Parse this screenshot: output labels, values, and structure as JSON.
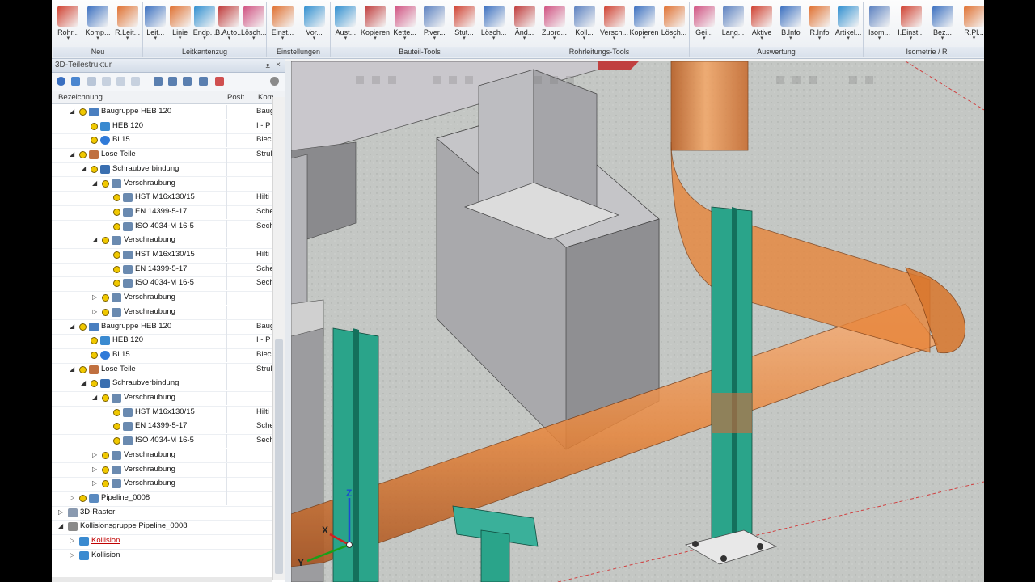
{
  "ribbon": {
    "groups": [
      {
        "title": "Neu",
        "buttons": [
          {
            "label": "Rohr...",
            "icon": "pipe-icon"
          },
          {
            "label": "Komp...",
            "icon": "component-icon"
          },
          {
            "label": "R.Leit...",
            "icon": "pipeline-icon"
          }
        ]
      },
      {
        "title": "Leitkantenzug",
        "buttons": [
          {
            "label": "Leit...",
            "icon": "guide-line-icon"
          },
          {
            "label": "Linie",
            "icon": "line-icon"
          },
          {
            "label": "Endp...",
            "icon": "endpoint-xyz-icon"
          },
          {
            "label": "B.Auto...",
            "icon": "auto-bend-icon"
          },
          {
            "label": "Lösch...",
            "icon": "delete-line-icon"
          }
        ]
      },
      {
        "title": "Einstellungen",
        "buttons": [
          {
            "label": "Einst...",
            "icon": "settings-icon"
          },
          {
            "label": "Vor...",
            "icon": "defaults-icon"
          }
        ]
      },
      {
        "title": "Bauteil-Tools",
        "buttons": [
          {
            "label": "Aust...",
            "icon": "replace-icon"
          },
          {
            "label": "Kopieren",
            "icon": "copy-icon"
          },
          {
            "label": "Kette...",
            "icon": "chain-icon"
          },
          {
            "label": "P.ver...",
            "icon": "move-point-icon"
          },
          {
            "label": "Stut...",
            "icon": "nozzle-icon"
          },
          {
            "label": "Lösch...",
            "icon": "delete-part-icon"
          }
        ]
      },
      {
        "title": "Rohrleitungs-Tools",
        "buttons": [
          {
            "label": "Änd...",
            "icon": "modify-icon"
          },
          {
            "label": "Zuord...",
            "icon": "assign-icon"
          },
          {
            "label": "Koll...",
            "icon": "collision-icon"
          },
          {
            "label": "Versch...",
            "icon": "move-icon"
          },
          {
            "label": "Kopieren",
            "icon": "copy-pipe-icon"
          },
          {
            "label": "Lösch...",
            "icon": "delete-pipe-icon"
          }
        ]
      },
      {
        "title": "Auswertung",
        "buttons": [
          {
            "label": "Gei...",
            "icon": "geometry-icon"
          },
          {
            "label": "Lang...",
            "icon": "length-sum-icon"
          },
          {
            "label": "Aktive",
            "icon": "active-icon"
          },
          {
            "label": "B.Info",
            "icon": "part-info-icon"
          },
          {
            "label": "R.Info",
            "icon": "pipe-info-icon"
          },
          {
            "label": "Artikel...",
            "icon": "article-icon"
          }
        ]
      },
      {
        "title": "Isometrie / R",
        "buttons": [
          {
            "label": "Isom...",
            "icon": "iso-icon"
          },
          {
            "label": "I.Einst...",
            "icon": "iso-settings-icon"
          },
          {
            "label": "Bez...",
            "icon": "reference-icon"
          },
          {
            "label": "R.Pl...",
            "icon": "pipe-plan-icon"
          }
        ]
      }
    ]
  },
  "panel": {
    "title": "3D-Teilestruktur",
    "pin": "ᴥ",
    "close": "×",
    "columns": {
      "name": "Bezeichnung",
      "pos": "Posit...",
      "kom": "Kom"
    },
    "rows": [
      {
        "level": 1,
        "exp": "◢",
        "name": "Baugruppe HEB 120",
        "kom": "Baug",
        "type": "assembly"
      },
      {
        "level": 2,
        "exp": "",
        "name": "HEB 120",
        "kom": "I - P",
        "type": "beam"
      },
      {
        "level": 2,
        "exp": "",
        "name": "Bl 15",
        "kom": "Blec",
        "type": "plate"
      },
      {
        "level": 1,
        "exp": "◢",
        "name": "Lose Teile",
        "kom": "Strul",
        "type": "loose"
      },
      {
        "level": 2,
        "exp": "◢",
        "name": "Schraubverbindung",
        "kom": "",
        "type": "bolt-group"
      },
      {
        "level": 3,
        "exp": "◢",
        "name": "Verschraubung",
        "kom": "",
        "type": "screw"
      },
      {
        "level": 4,
        "exp": "",
        "name": "HST M16x130/15",
        "kom": "Hilti",
        "type": "screw"
      },
      {
        "level": 4,
        "exp": "",
        "name": "EN 14399-5-17",
        "kom": "Sche",
        "type": "screw"
      },
      {
        "level": 4,
        "exp": "",
        "name": "ISO 4034-M 16-5",
        "kom": "Sech",
        "type": "screw"
      },
      {
        "level": 3,
        "exp": "◢",
        "name": "Verschraubung",
        "kom": "",
        "type": "screw"
      },
      {
        "level": 4,
        "exp": "",
        "name": "HST M16x130/15",
        "kom": "Hilti",
        "type": "screw"
      },
      {
        "level": 4,
        "exp": "",
        "name": "EN 14399-5-17",
        "kom": "Sche",
        "type": "screw"
      },
      {
        "level": 4,
        "exp": "",
        "name": "ISO 4034-M 16-5",
        "kom": "Sech",
        "type": "screw"
      },
      {
        "level": 3,
        "exp": "▷",
        "name": "Verschraubung",
        "kom": "",
        "type": "screw"
      },
      {
        "level": 3,
        "exp": "▷",
        "name": "Verschraubung",
        "kom": "",
        "type": "screw"
      },
      {
        "level": 1,
        "exp": "◢",
        "name": "Baugruppe HEB 120",
        "kom": "Baug",
        "type": "assembly"
      },
      {
        "level": 2,
        "exp": "",
        "name": "HEB 120",
        "kom": "I - P",
        "type": "beam"
      },
      {
        "level": 2,
        "exp": "",
        "name": "Bl 15",
        "kom": "Blec",
        "type": "plate"
      },
      {
        "level": 1,
        "exp": "◢",
        "name": "Lose Teile",
        "kom": "Strul",
        "type": "loose"
      },
      {
        "level": 2,
        "exp": "◢",
        "name": "Schraubverbindung",
        "kom": "",
        "type": "bolt-group"
      },
      {
        "level": 3,
        "exp": "◢",
        "name": "Verschraubung",
        "kom": "",
        "type": "screw"
      },
      {
        "level": 4,
        "exp": "",
        "name": "HST M16x130/15",
        "kom": "Hilti",
        "type": "screw"
      },
      {
        "level": 4,
        "exp": "",
        "name": "EN 14399-5-17",
        "kom": "Sche",
        "type": "screw"
      },
      {
        "level": 4,
        "exp": "",
        "name": "ISO 4034-M 16-5",
        "kom": "Sech",
        "type": "screw"
      },
      {
        "level": 3,
        "exp": "▷",
        "name": "Verschraubung",
        "kom": "",
        "type": "screw"
      },
      {
        "level": 3,
        "exp": "▷",
        "name": "Verschraubung",
        "kom": "",
        "type": "screw"
      },
      {
        "level": 3,
        "exp": "▷",
        "name": "Verschraubung",
        "kom": "",
        "type": "screw"
      },
      {
        "level": 1,
        "exp": "▷",
        "name": "Pipeline_0008",
        "kom": "",
        "type": "pipeline"
      },
      {
        "level": 0,
        "exp": "▷",
        "name": "3D-Raster",
        "kom": "",
        "type": "grid"
      },
      {
        "level": 0,
        "exp": "◢",
        "name": "Kollisionsgruppe Pipeline_0008",
        "kom": "",
        "type": "collision-group"
      },
      {
        "level": 1,
        "exp": "▷",
        "name": "Kollision",
        "kom": "",
        "type": "collision",
        "red": true
      },
      {
        "level": 1,
        "exp": "▷",
        "name": "Kollision",
        "kom": "",
        "type": "collision"
      }
    ]
  },
  "viewport": {
    "axes": {
      "x": "X",
      "y": "Y",
      "z": "Z"
    }
  },
  "colors": {
    "pipe": "#e8853a",
    "steel": "#2aa48a",
    "concrete": "#b8b8b8",
    "ribbon_accent": "#d04030",
    "collision": "#c00000"
  }
}
